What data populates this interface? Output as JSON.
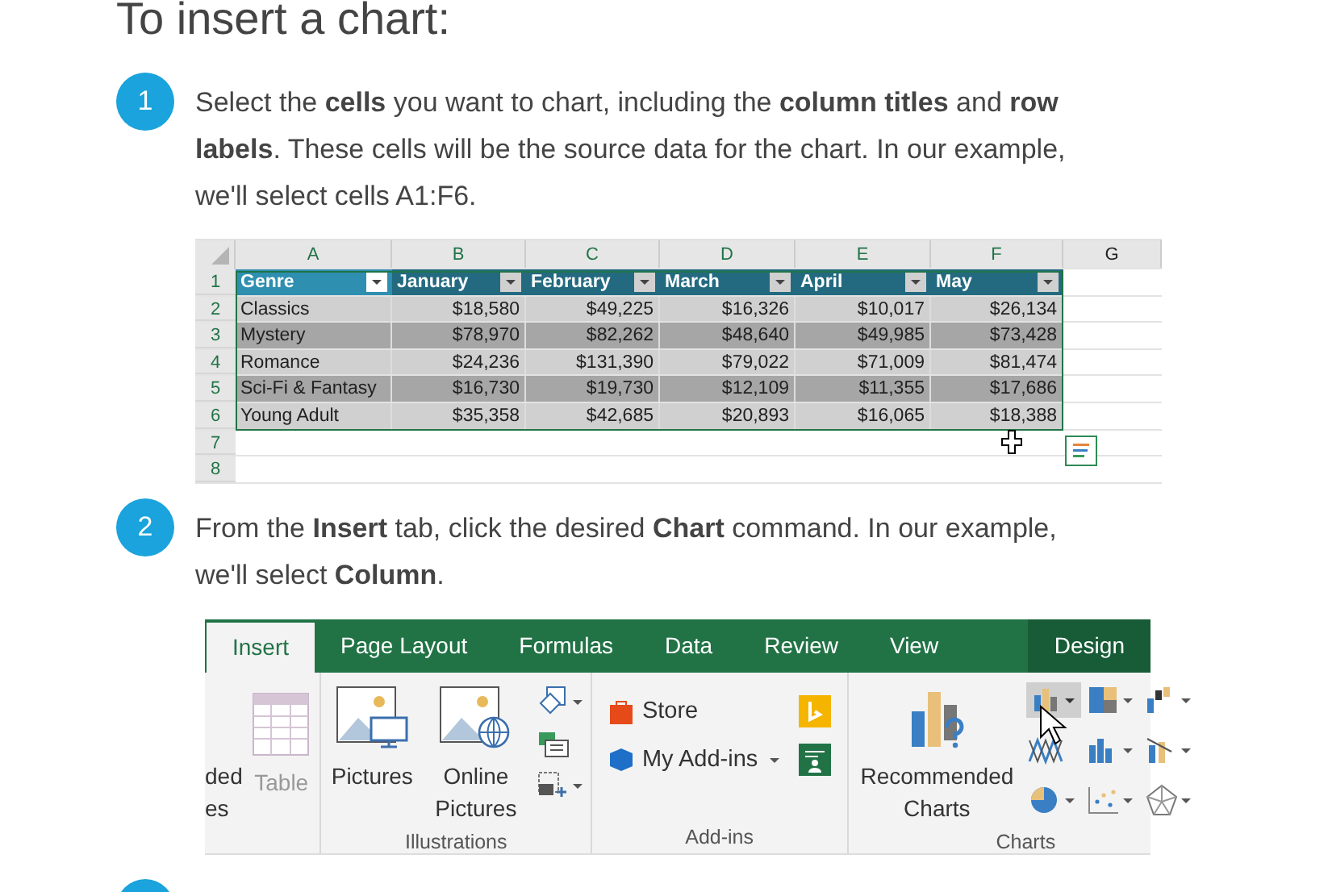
{
  "title": "To insert a chart:",
  "steps": [
    {
      "number": "1",
      "text": "Select the **cells** you want to chart, including the **column titles** and **row labels**. These cells will be the source data for the chart. In our example, we'll select cells A1:F6."
    },
    {
      "number": "2",
      "text": "From the **Insert** tab, click the desired **Chart** command. In our example, we'll select **Column**."
    }
  ],
  "next_step_partial": true,
  "spreadsheet": {
    "columns": [
      "A",
      "B",
      "C",
      "D",
      "E",
      "F",
      "G"
    ],
    "rows": [
      {
        "number": "1",
        "kind": "header",
        "cells": [
          "Genre",
          "January",
          "February",
          "March",
          "April",
          "May"
        ]
      },
      {
        "number": "2",
        "kind": "data",
        "cells": [
          "Classics",
          "$18,580",
          "$49,225",
          "$16,326",
          "$10,017",
          "$26,134"
        ]
      },
      {
        "number": "3",
        "kind": "data",
        "cells": [
          "Mystery",
          "$78,970",
          "$82,262",
          "$48,640",
          "$49,985",
          "$73,428"
        ]
      },
      {
        "number": "4",
        "kind": "data",
        "cells": [
          "Romance",
          "$24,236",
          "$131,390",
          "$79,022",
          "$71,009",
          "$81,474"
        ]
      },
      {
        "number": "5",
        "kind": "data",
        "cells": [
          "Sci-Fi & Fantasy",
          "$16,730",
          "$19,730",
          "$12,109",
          "$11,355",
          "$17,686"
        ]
      },
      {
        "number": "6",
        "kind": "data",
        "cells": [
          "Young Adult",
          "$35,358",
          "$42,685",
          "$20,893",
          "$16,065",
          "$18,388"
        ]
      },
      {
        "number": "7",
        "kind": "empty",
        "cells": []
      },
      {
        "number": "8",
        "kind": "empty",
        "cells": []
      }
    ]
  },
  "ribbon": {
    "tabs": [
      {
        "label": "Insert",
        "selected": true,
        "contextual": false
      },
      {
        "label": "Page Layout",
        "selected": false,
        "contextual": false
      },
      {
        "label": "Formulas",
        "selected": false,
        "contextual": false
      },
      {
        "label": "Data",
        "selected": false,
        "contextual": false
      },
      {
        "label": "Review",
        "selected": false,
        "contextual": false
      },
      {
        "label": "View",
        "selected": false,
        "contextual": false
      },
      {
        "label": "Design",
        "selected": false,
        "contextual": true
      }
    ],
    "tables_group": {
      "cut_label_1": "ded",
      "cut_label_2": "es",
      "table_label": "Table",
      "table_disabled": true
    },
    "illustrations": {
      "pictures": "Pictures",
      "online_pictures": "Online Pictures",
      "label": "Illustrations"
    },
    "addins": {
      "store": "Store",
      "my_addins": "My Add-ins",
      "label": "Add-ins"
    },
    "charts": {
      "recommended": "Recommended Charts",
      "label": "Charts"
    }
  }
}
